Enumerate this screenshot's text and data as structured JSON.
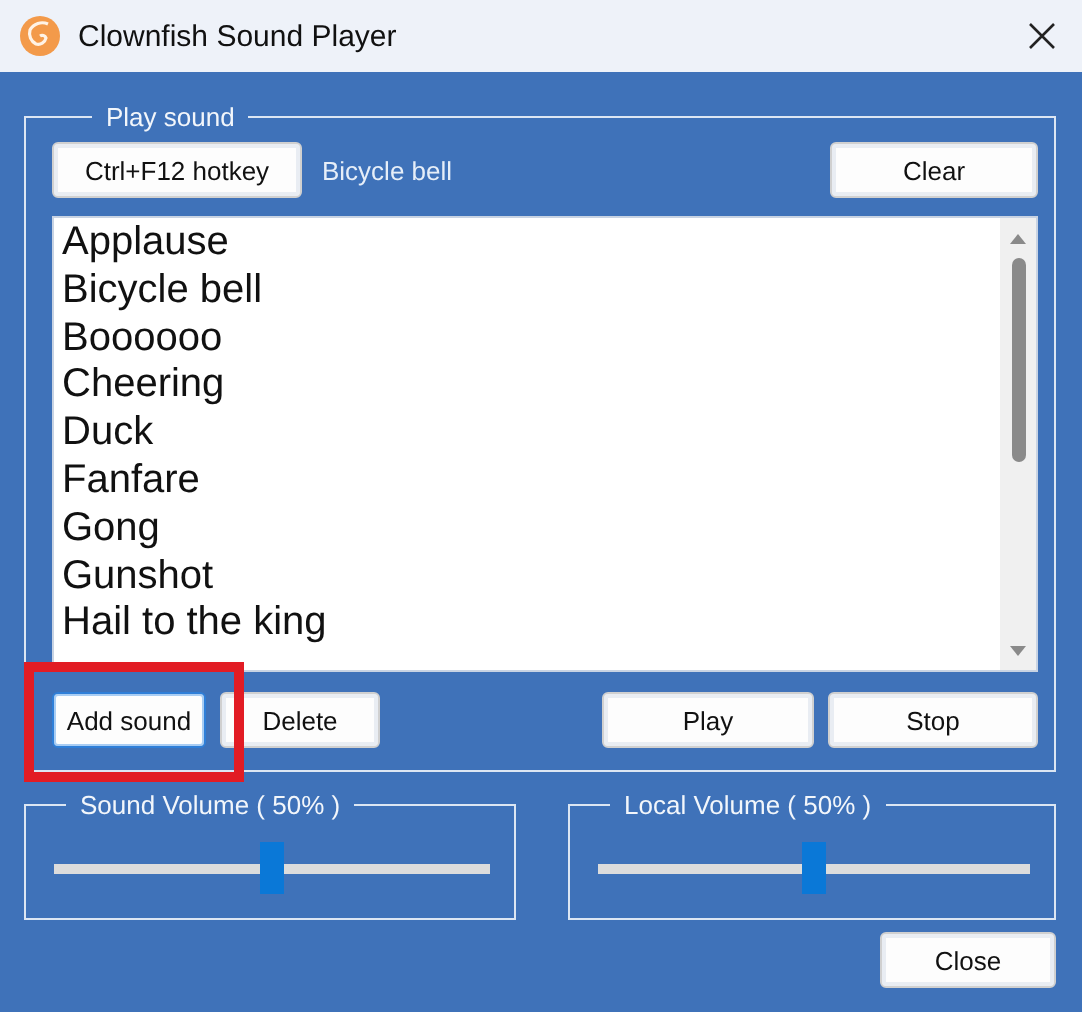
{
  "window": {
    "title": "Clownfish Sound Player"
  },
  "play_sound": {
    "legend": "Play sound",
    "hotkey_button": "Ctrl+F12 hotkey",
    "hotkey_sound": "Bicycle bell",
    "clear_button": "Clear",
    "sounds": [
      "Applause",
      "Bicycle bell",
      "Boooooo",
      "Cheering",
      "Duck",
      "Fanfare",
      "Gong",
      "Gunshot",
      "Hail to the king"
    ],
    "buttons": [
      {
        "label": "Add sound",
        "focused": true,
        "highlighted": true
      },
      {
        "label": "Delete",
        "focused": false,
        "highlighted": false
      },
      {
        "label": "Play",
        "focused": false,
        "highlighted": false
      },
      {
        "label": "Stop",
        "focused": false,
        "highlighted": false
      }
    ]
  },
  "volumes": [
    {
      "label": "Sound Volume ( 50% )",
      "level": 0.5
    },
    {
      "label": "Local Volume ( 50% )",
      "level": 0.5
    }
  ],
  "close_button": "Close"
}
